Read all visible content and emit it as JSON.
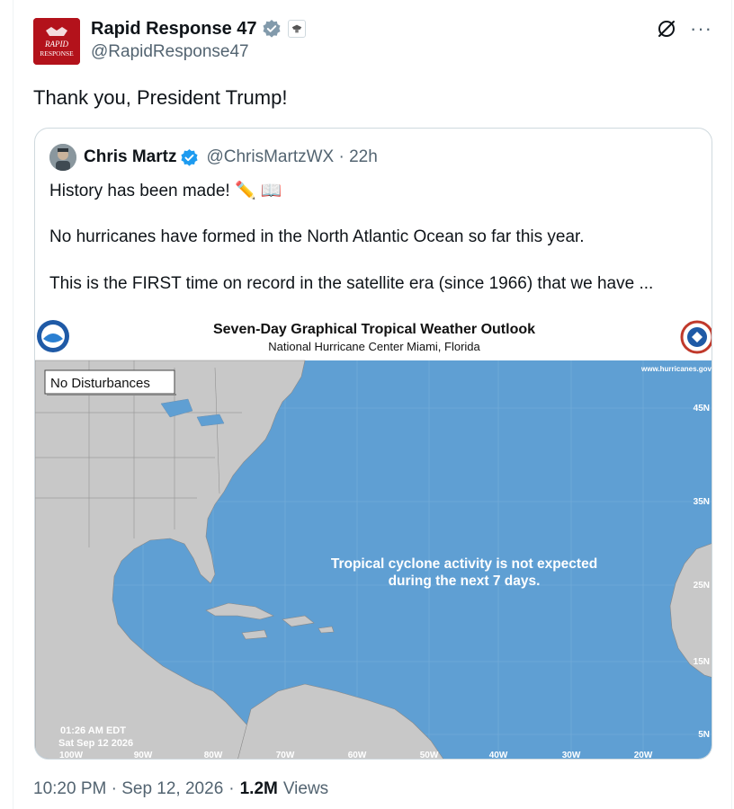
{
  "post": {
    "author": {
      "display_name": "Rapid Response 47",
      "handle": "@RapidResponse47",
      "verified": true,
      "avatar_text": "RAPID RESPONSE",
      "accent": "#b3121b"
    },
    "text": "Thank you, President Trump!",
    "quote": {
      "author": {
        "display_name": "Chris Martz",
        "handle": "@ChrisMartzWX",
        "time_ago": "22h",
        "verified": true
      },
      "lines": [
        "History has been made! ✏️ 📖",
        "No hurricanes have formed in the North Atlantic Ocean so far this year.",
        "This is the FIRST time on record in the satellite era (since 1966) that we have ..."
      ],
      "map": {
        "title": "Seven-Day Graphical Tropical Weather Outlook",
        "subtitle": "National Hurricane Center  Miami, Florida",
        "badge": "No Disturbances",
        "website": "www.hurricanes.gov",
        "message_line1": "Tropical cyclone activity is not expected",
        "message_line2": "during the next 7 days.",
        "timestamp_time": "01:26 AM EDT",
        "timestamp_date": "Sat Sep 12 2026",
        "lat_labels": [
          "45N",
          "35N",
          "25N",
          "15N",
          "5N"
        ],
        "lon_labels": [
          "100W",
          "90W",
          "80W",
          "70W",
          "60W",
          "50W",
          "40W",
          "30W",
          "20W"
        ],
        "ocean_color": "#5f9fd3",
        "land_color": "#c8c8c8"
      }
    },
    "timestamp": "10:20 PM · Sep 12, 2026",
    "views_count": "1.2M",
    "views_label": "Views",
    "sep": "·",
    "verified_color": "#1d9bf0"
  }
}
